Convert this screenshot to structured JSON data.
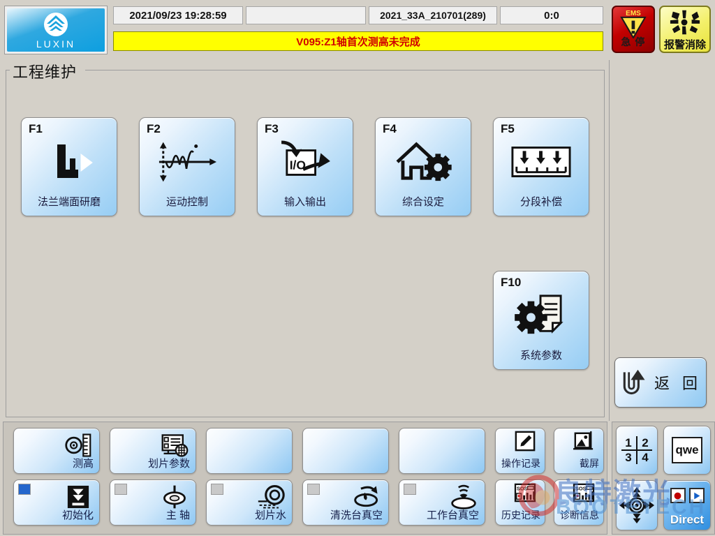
{
  "brand": {
    "logo_text": "LUXIN",
    "logo_icon": "luxin-chevron-emblem-icon"
  },
  "statusbar": {
    "fields": [
      {
        "name": "datetime",
        "value": "2021/09/23 19:28:59"
      },
      {
        "name": "blank",
        "value": ""
      },
      {
        "name": "recipe",
        "value": "2021_33A_210701(289)"
      },
      {
        "name": "counter",
        "value": "0:0"
      }
    ],
    "alarm_message": "V095:Z1轴首次测高未完成",
    "alarm_bg": "#ffff00",
    "alarm_fg": "#d00000"
  },
  "emergency": {
    "ems_label": "EMS",
    "ems_cn": "急 停",
    "icon": "warning-triangle-icon",
    "color": "#c20000"
  },
  "alarm_clear": {
    "label": "报警消除",
    "icon": "alarm-burst-icon",
    "color": "#f3f06a"
  },
  "group": {
    "title": "工程维护"
  },
  "function_buttons": [
    {
      "key": "F1",
      "label": "法兰端面研磨",
      "icon": "flange-grinding-icon"
    },
    {
      "key": "F2",
      "label": "运动控制",
      "icon": "motion-waveform-icon"
    },
    {
      "key": "F3",
      "label": "输入输出",
      "icon": "io-arrows-icon"
    },
    {
      "key": "F4",
      "label": "综合设定",
      "icon": "house-gear-icon"
    },
    {
      "key": "F5",
      "label": "分段补偿",
      "icon": "segment-compensation-icon"
    },
    {
      "key": "F10",
      "label": "系统参数",
      "icon": "gear-document-icon"
    }
  ],
  "return_button": {
    "label": "返 回",
    "icon": "u-turn-arrow-icon"
  },
  "bottom_buttons": {
    "row_top": [
      {
        "label": "测高",
        "icon": "height-measure-icon",
        "led": null
      },
      {
        "label": "划片参数",
        "icon": "dicing-params-icon",
        "led": null
      },
      {
        "label": "",
        "icon": null,
        "led": null
      },
      {
        "label": "",
        "icon": null,
        "led": null
      },
      {
        "label": "",
        "icon": null,
        "led": null
      }
    ],
    "row_bottom": [
      {
        "label": "初始化",
        "icon": "init-download-icon",
        "led": "on"
      },
      {
        "label": "主 轴",
        "icon": "spindle-icon",
        "led": "off"
      },
      {
        "label": "划片水",
        "icon": "dicing-water-icon",
        "led": "off"
      },
      {
        "label": "清洗台真空",
        "icon": "clean-vacuum-icon",
        "led": "off"
      },
      {
        "label": "工作台真空",
        "icon": "table-vacuum-icon",
        "led": "off"
      }
    ],
    "utility": [
      {
        "label": "操作记录",
        "icon": "pencil-note-icon"
      },
      {
        "label": "截屏",
        "icon": "screenshot-icon"
      },
      {
        "label": "历史记录",
        "icon": "sos-chart-icon"
      },
      {
        "label": "诊断信息",
        "icon": "sos-chart-icon"
      }
    ]
  },
  "keypad": {
    "numeric": {
      "icon": "numeric-keypad-icon",
      "cells": [
        "1",
        "2",
        "3",
        "4"
      ]
    },
    "qwerty": {
      "icon": "qwerty-keyboard-icon",
      "label": "qwe"
    },
    "dpad": {
      "icon": "direction-pad-icon"
    },
    "direct": {
      "label": "Direct",
      "icons": [
        "record-icon",
        "play-icon"
      ]
    }
  },
  "led_colors": {
    "on": "#2466cc",
    "off": "#c9c9c9"
  },
  "watermark": {
    "cn": "良特激光",
    "en": "BOOTETECH",
    "icon": "bootetech-logo-icon"
  }
}
